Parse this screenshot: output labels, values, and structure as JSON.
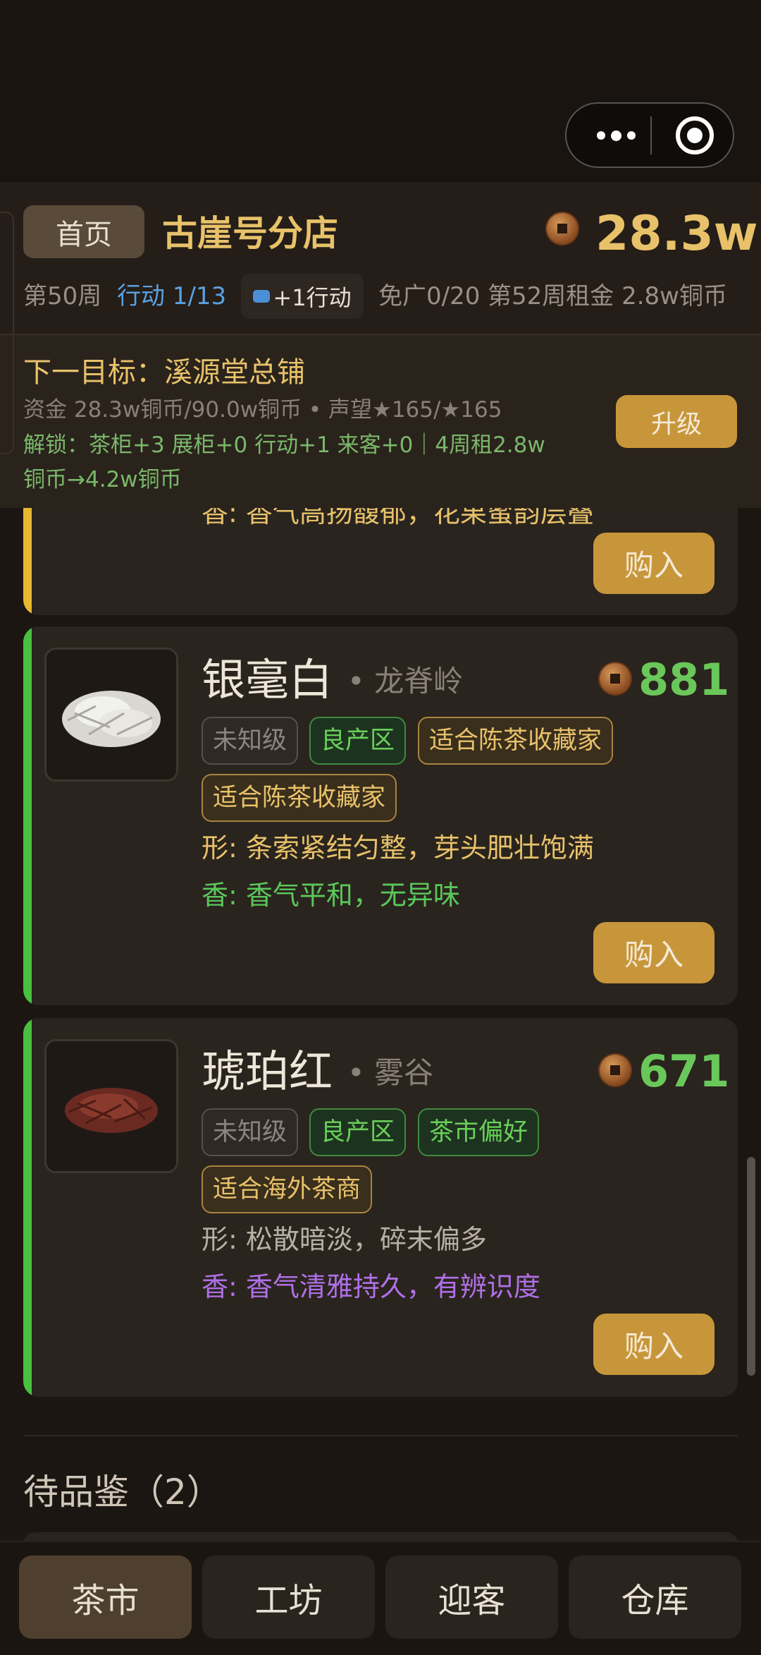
{
  "header": {
    "home_label": "首页",
    "store_name": "古崖号分店",
    "money": "28.3w",
    "week": "第50周",
    "actions": "行动 1/13",
    "action_chip": "+1行动",
    "free_ads": "免广0/20",
    "rent": "第52周租金 2.8w铜币"
  },
  "next_target": {
    "title": "下一目标：溪源堂总铺",
    "progress": "资金 28.3w铜币/90.0w铜币 • 声望★165/★165",
    "unlock": "解锁：茶柜+3 展柜+0 行动+1 来客+0｜4周租2.8w铜币→4.2w铜币",
    "upgrade_label": "升级"
  },
  "partial_card": {
    "clipped_text": "香: 香气高扬馥郁，花果蜜韵层叠",
    "buy_label": "购入",
    "accent": "#e8b830"
  },
  "cards": [
    {
      "name": "银毫白",
      "origin": "• 龙脊岭",
      "price": "881",
      "tags": [
        "未知级",
        "良产区",
        "适合陈茶收藏家",
        "适合陈茶收藏家"
      ],
      "shape": "形: 条索紧结匀整，芽头肥壮饱满",
      "aroma": "香: 香气平和，无异味",
      "buy_label": "购入",
      "accent": "#4ac040"
    },
    {
      "name": "琥珀红",
      "origin": "• 雾谷",
      "price": "671",
      "tags": [
        "未知级",
        "良产区",
        "茶市偏好",
        "适合海外茶商"
      ],
      "shape": "形: 松散暗淡，碎末偏多",
      "aroma": "香: 香气清雅持久，有辨识度",
      "buy_label": "购入",
      "accent": "#4ac040"
    }
  ],
  "pending": {
    "title": "待品鉴（2）"
  },
  "tabs": [
    "茶市",
    "工坊",
    "迎客",
    "仓库"
  ],
  "colors": {
    "gold": "#e8c26a",
    "price_green": "#6ac85a",
    "button": "#c8963a",
    "shape_gold": "#e8c26a",
    "aroma_green": "#5ac85a",
    "shape_grey": "#b8b0a4",
    "aroma_purple": "#b070e8"
  }
}
